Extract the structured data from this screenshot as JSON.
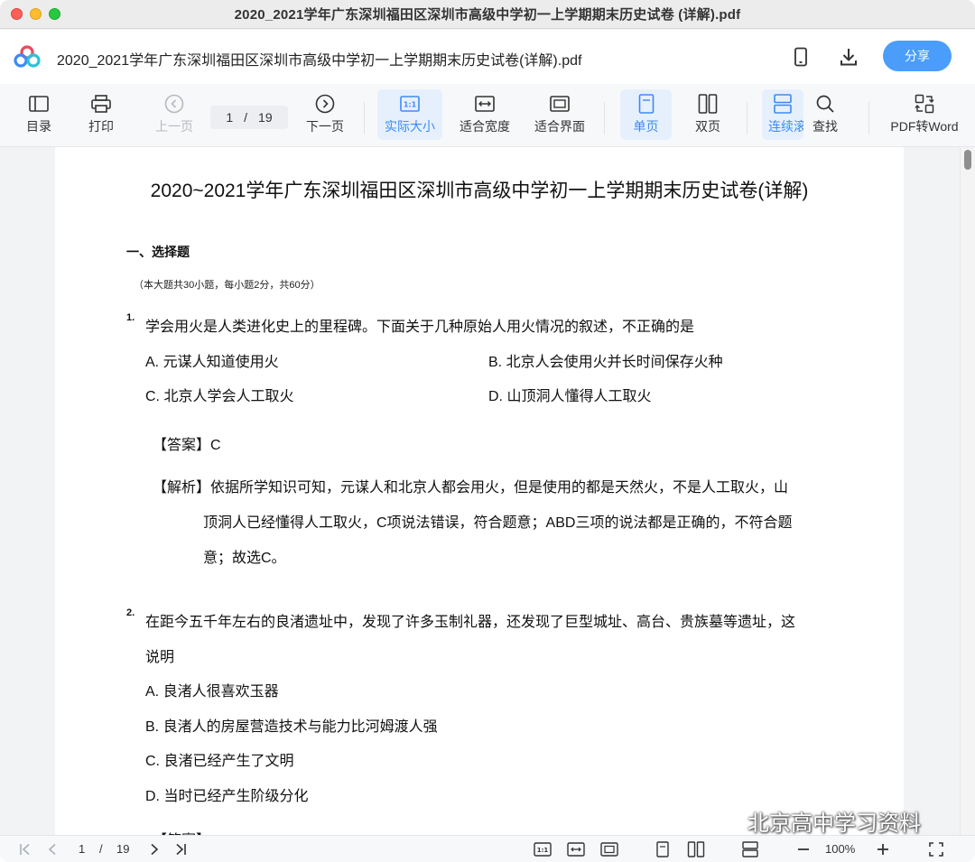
{
  "window": {
    "title": "2020_2021学年广东深圳福田区深圳市高级中学初一上学期期末历史试卷 (详解).pdf"
  },
  "header": {
    "doc_name": "2020_2021学年广东深圳福田区深圳市高级中学初一上学期期末历史试卷(详解).pdf",
    "share_label": "分享"
  },
  "toolbar": {
    "toc": "目录",
    "print": "打印",
    "prev": "上一页",
    "page_current": "1",
    "page_sep": "/",
    "page_total": "19",
    "next": "下一页",
    "actual_size": "实际大小",
    "fit_width": "适合宽度",
    "fit_page": "适合界面",
    "single": "单页",
    "double": "双页",
    "continuous": "连续滚",
    "find": "查找",
    "to_word": "PDF转Word"
  },
  "doc": {
    "title": "2020~2021学年广东深圳福田区深圳市高级中学初一上学期期末历史试卷(详解)",
    "section": "一、选择题",
    "section_note": "（本大题共30小题，每小题2分，共60分）",
    "q1": {
      "num": "1.",
      "stem": "学会用火是人类进化史上的里程碑。下面关于几种原始人用火情况的叙述，不正确的是",
      "a": "A. 元谋人知道使用火",
      "b": "B. 北京人会使用火并长时间保存火种",
      "c": "C. 北京人学会人工取火",
      "d": "D. 山顶洞人懂得人工取火",
      "answer": "【答案】C",
      "analysis_1": "【解析】依据所学知识可知，元谋人和北京人都会用火，但是使用的都是天然火，不是人工取火，山",
      "analysis_2": "顶洞人已经懂得人工取火，C项说法错误，符合题意；ABD三项的说法都是正确的，不符合题",
      "analysis_3": "意；故选C。"
    },
    "q2": {
      "num": "2.",
      "stem_1": "在距今五千年左右的良渚遗址中，发现了许多玉制礼器，还发现了巨型城址、高台、贵族墓等遗址，这",
      "stem_2": "说明",
      "a": "A. 良渚人很喜欢玉器",
      "b": "B. 良渚人的房屋营造技术与能力比河姆渡人强",
      "c": "C. 良渚已经产生了文明",
      "d": "D. 当时已经产生阶级分化",
      "answer_partial": "【答案】C"
    }
  },
  "bottom": {
    "page_current": "1",
    "page_sep": "/",
    "page_total": "19",
    "zoom": "100%"
  },
  "watermark": "北京高中学习资料",
  "colors": {
    "accent": "#4b9dfb",
    "active_bg": "#e6f0fd",
    "active_text": "#3d8af7"
  }
}
